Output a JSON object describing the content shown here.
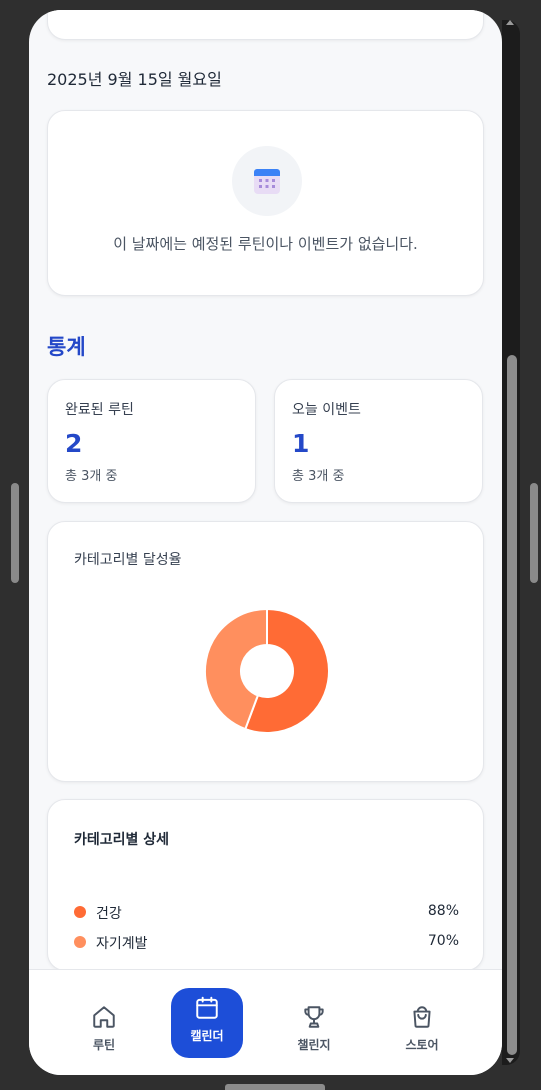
{
  "date_heading": "2025년 9월 15일 월요일",
  "empty_state": {
    "icon": "calendar-icon",
    "message": "이 날짜에는 예정된 루틴이나 이벤트가 없습니다."
  },
  "stats": {
    "title": "통계",
    "cards": [
      {
        "label": "완료된 루틴",
        "value": "2",
        "sub": "총 3개 중"
      },
      {
        "label": "오늘 이벤트",
        "value": "1",
        "sub": "총 3개 중"
      }
    ]
  },
  "category_chart": {
    "title": "카테고리별 달성율"
  },
  "chart_data": {
    "type": "pie",
    "donut": true,
    "categories": [
      "건강",
      "자기계발"
    ],
    "values": [
      88,
      70
    ],
    "colors": [
      "#ff6b35",
      "#ff8f5e"
    ]
  },
  "category_detail": {
    "title": "카테고리별 상세",
    "items": [
      {
        "name": "건강",
        "percent": "88%",
        "color": "#ff6b35"
      },
      {
        "name": "자기계발",
        "percent": "70%",
        "color": "#ff8f5e"
      }
    ]
  },
  "nav": {
    "active": "calendar",
    "items": [
      {
        "key": "routine",
        "label": "루틴",
        "icon": "home-icon"
      },
      {
        "key": "calendar",
        "label": "캘린더",
        "icon": "calendar-icon"
      },
      {
        "key": "challenge",
        "label": "챌린지",
        "icon": "trophy-icon"
      },
      {
        "key": "store",
        "label": "스토어",
        "icon": "shopping-bag-icon"
      }
    ]
  },
  "colors": {
    "accent": "#1d4ed8",
    "title_blue": "#2448c8"
  }
}
